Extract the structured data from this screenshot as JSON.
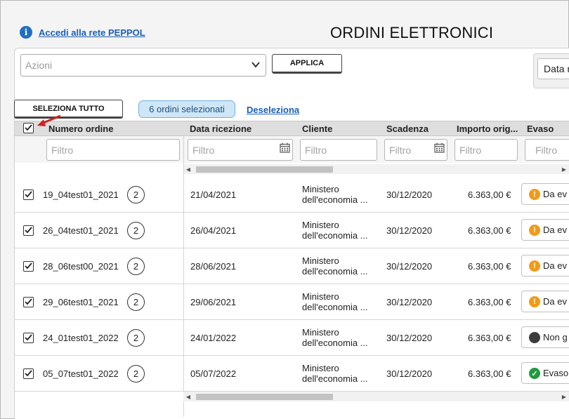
{
  "header": {
    "peppol_link": "Accedi alla rete PEPPOL",
    "title": "ORDINI ELETTRONICI"
  },
  "toolbar": {
    "actions_placeholder": "Azioni",
    "apply_label": "APPLICA",
    "date_filter_label": "Data ri"
  },
  "selection": {
    "select_all_label": "SELEZIONA TUTTO",
    "selected_badge": "6 ordini selezionati",
    "deselect_label": "Deseleziona"
  },
  "columns": {
    "order_number": "Numero ordine",
    "received_date": "Data ricezione",
    "client": "Cliente",
    "due_date": "Scadenza",
    "amount": "Importo orig...",
    "processed": "Evaso"
  },
  "filter_placeholder": "Filtro",
  "colors": {
    "link": "#1a5fb4",
    "badge_bg": "#cfe6f7",
    "status_pending": "#f29a17",
    "status_none": "#3c3c3c",
    "status_done": "#1f9a3c"
  },
  "rows": [
    {
      "order": "19_04test01_2021",
      "count": "2",
      "received": "21/04/2021",
      "client_line1": "Ministero",
      "client_line2": "dell'economia ...",
      "due": "30/12/2020",
      "amount": "6.363,00 €",
      "status": "Da ev",
      "status_icon": "warning-icon",
      "status_kind": "pending"
    },
    {
      "order": "26_04test01_2021",
      "count": "2",
      "received": "26/04/2021",
      "client_line1": "Ministero",
      "client_line2": "dell'economia ...",
      "due": "30/12/2020",
      "amount": "6.363,00 €",
      "status": "Da ev",
      "status_icon": "warning-icon",
      "status_kind": "pending"
    },
    {
      "order": "28_06test00_2021",
      "count": "2",
      "received": "28/06/2021",
      "client_line1": "Ministero",
      "client_line2": "dell'economia ...",
      "due": "30/12/2020",
      "amount": "6.363,00 €",
      "status": "Da ev",
      "status_icon": "warning-icon",
      "status_kind": "pending"
    },
    {
      "order": "29_06test01_2021",
      "count": "2",
      "received": "29/06/2021",
      "client_line1": "Ministero",
      "client_line2": "dell'economia ...",
      "due": "30/12/2020",
      "amount": "6.363,00 €",
      "status": "Da ev",
      "status_icon": "warning-icon",
      "status_kind": "pending"
    },
    {
      "order": "24_01test01_2022",
      "count": "2",
      "received": "24/01/2022",
      "client_line1": "Ministero",
      "client_line2": "dell'economia ...",
      "due": "30/12/2020",
      "amount": "6.363,00 €",
      "status": "Non g",
      "status_icon": "dot-icon",
      "status_kind": "none"
    },
    {
      "order": "05_07test01_2022",
      "count": "2",
      "received": "05/07/2022",
      "client_line1": "Ministero",
      "client_line2": "dell'economia ...",
      "due": "30/12/2020",
      "amount": "6.363,00 €",
      "status": "Evaso",
      "status_icon": "check-icon",
      "status_kind": "done"
    }
  ]
}
